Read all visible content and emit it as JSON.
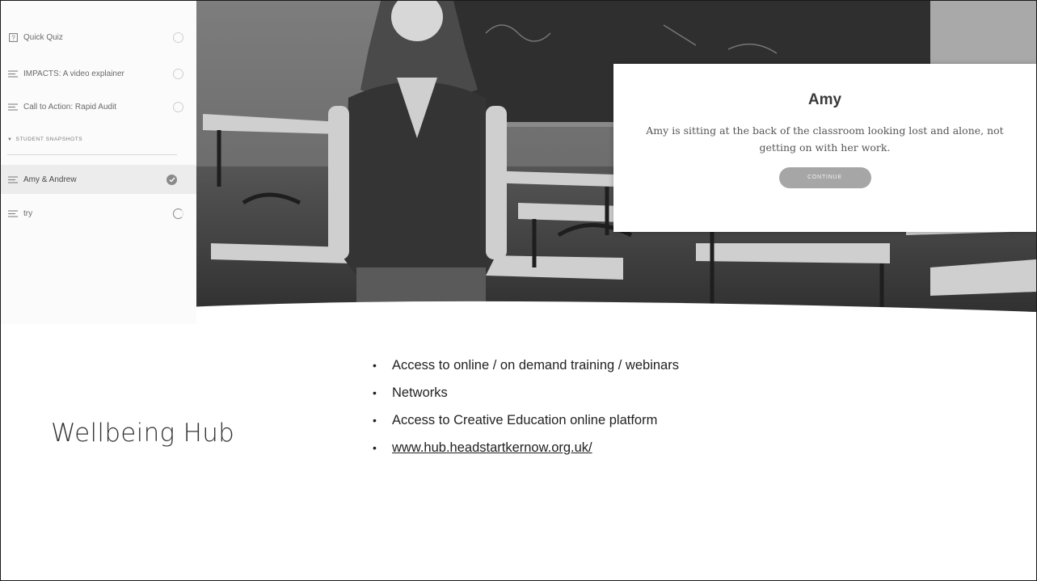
{
  "sidebar": {
    "items": [
      {
        "label": "Quick Quiz",
        "icon": "quiz-icon",
        "status": "incomplete"
      },
      {
        "label": "IMPACTS: A video explainer",
        "icon": "lesson-lines-icon",
        "status": "incomplete"
      },
      {
        "label": "Call to Action: Rapid Audit",
        "icon": "lesson-lines-icon",
        "status": "incomplete"
      }
    ],
    "section": {
      "label": "STUDENT SNAPSHOTS",
      "icon": "caret-down-icon"
    },
    "section_items": [
      {
        "label": "Amy & Andrew",
        "icon": "lesson-lines-icon",
        "status": "complete",
        "active": true
      },
      {
        "label": "try",
        "icon": "lesson-lines-icon",
        "status": "in-progress"
      }
    ]
  },
  "card": {
    "title": "Amy",
    "body": "Amy is sitting at the back of the classroom looking lost and alone, not getting on with her work.",
    "button": "CONTINUE"
  },
  "slide": {
    "title": "Wellbeing Hub",
    "bullets": [
      "Access to online / on demand training / webinars",
      "Networks",
      "Access to Creative Education online platform"
    ],
    "link": "www.hub.headstartkernow.org.uk/"
  },
  "colors": {
    "sidebar_bg": "#fbfbfb",
    "active_bg": "#ececec",
    "button": "#a6a6a6",
    "text": "#222222"
  }
}
